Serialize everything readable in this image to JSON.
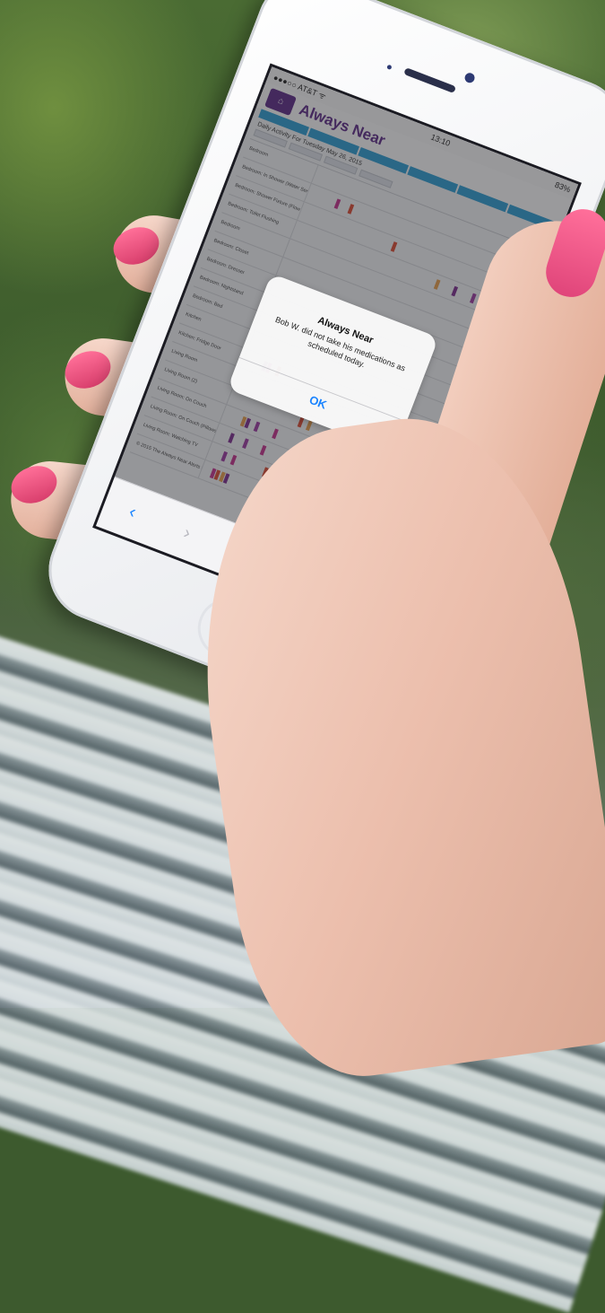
{
  "status_bar": {
    "carrier": "●●●○○ AT&T ᯤ",
    "time": "13:10",
    "battery": "83%"
  },
  "site": {
    "name": "Always Near"
  },
  "page": {
    "heading": "Daily Activity For Tuesday May 26, 2015"
  },
  "rows": [
    "Bedroom",
    "Bedroom: In Shower (Water Sensor)",
    "Bedroom: Shower Fixture (Flow Water)",
    "Bedroom: Toilet Flushing",
    "Bedroom",
    "Bedroom: Closet",
    "Bedroom: Dresser",
    "Bedroom: Nightstand",
    "Bedroom: Bed",
    "Kitchen",
    "Kitchen: Fridge Door",
    "Living Room",
    "Living Room (2)",
    "Living Room: On Couch",
    "Living Room: On Couch (Pillows)",
    "Living Room: Watching TV",
    "© 2015 The Always Near Alerts Network"
  ],
  "alert": {
    "title": "Always Near",
    "message": "Bob W. did not take his medications as scheduled today.",
    "button": "OK"
  },
  "toolbar": {
    "back": "‹",
    "forward": "›",
    "share": "⇪",
    "bookmarks": "📖",
    "tabs": "❐"
  },
  "colors": {
    "accent": "#5b2a86",
    "nav": "#2d9bd0",
    "link": "#1a84ff",
    "nail": "#e0457a"
  }
}
